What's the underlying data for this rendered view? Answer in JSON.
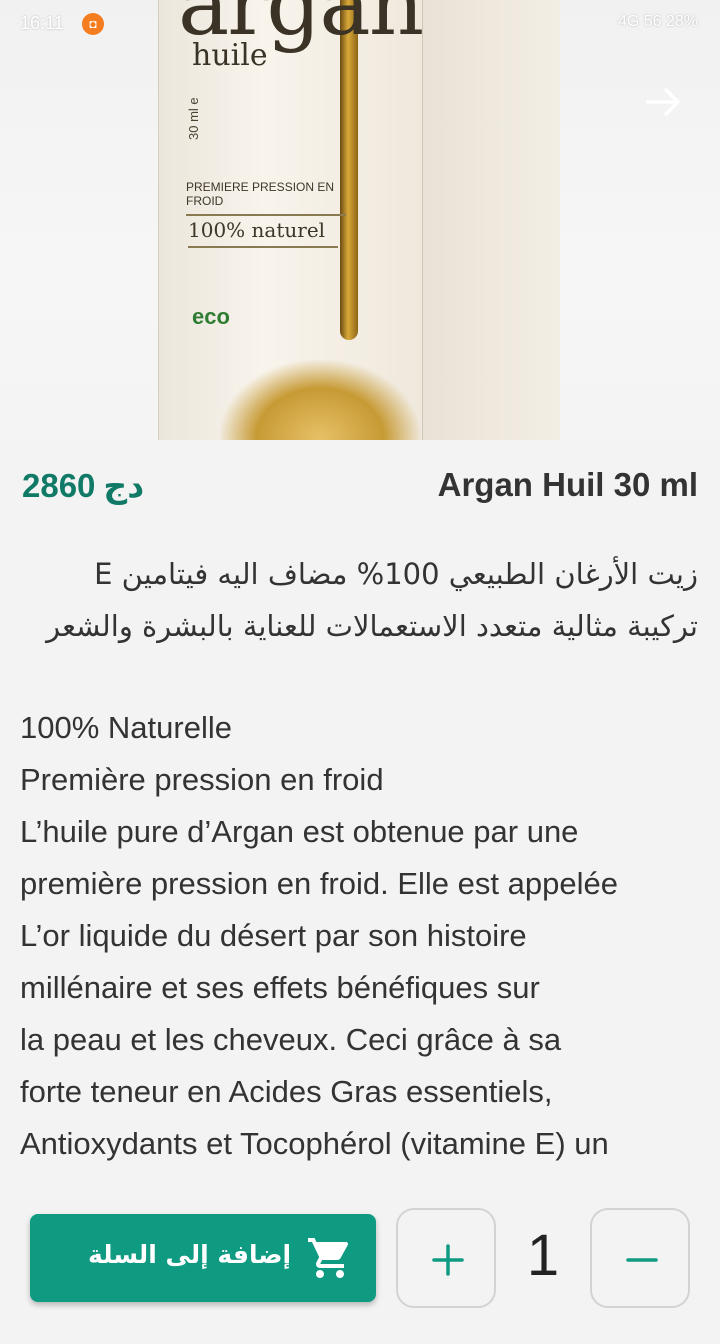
{
  "status_bar": {
    "time": "16:11",
    "right_text": "4G 56 28%"
  },
  "product": {
    "title": "Argan Huil 30 ml",
    "price": "2860",
    "currency": "دج",
    "description_ar": [
      "زيت الأرغان الطبيعي 100% مضاف اليه فيتامين E",
      "تركيبة مثالية متعدد الاستعمالات للعناية بالبشرة والشعر"
    ],
    "description_fr": [
      "100% Naturelle",
      "Première pression en froid",
      "L’huile pure d’Argan est obtenue par une",
      "première pression en froid. Elle est appelée",
      "L’or liquide du désert par son histoire",
      "millénaire et ses effets bénéfiques sur",
      "la peau et les cheveux. Ceci grâce à sa",
      "forte teneur en Acides Gras essentiels,",
      "Antioxydants et Tocophérol (vitamine E) un"
    ]
  },
  "packaging": {
    "brand": "argan",
    "brand_sub": "huile",
    "volume": "30 ml e",
    "tag1": "PREMIERE PRESSION EN FROID",
    "tag2": "100% naturel",
    "eco": "eco"
  },
  "actions": {
    "add_to_cart": "إضافة إلى السلة",
    "quantity": "1",
    "plus": "+",
    "minus": "−"
  },
  "colors": {
    "accent": "#0f9a82",
    "price": "#107a66",
    "background": "#f3f3f3"
  },
  "icons": {
    "cart": "shopping-cart-icon",
    "share": "arrow-right-icon",
    "plus": "plus-icon",
    "minus": "minus-icon"
  }
}
